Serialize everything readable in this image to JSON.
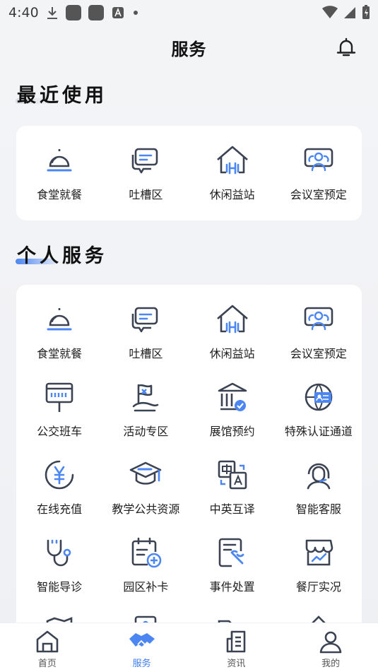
{
  "status": {
    "time": "4:40"
  },
  "header": {
    "title": "服务"
  },
  "recent": {
    "title": "最近使用",
    "items": [
      {
        "label": "食堂就餐",
        "icon": "cloche-icon"
      },
      {
        "label": "吐槽区",
        "icon": "chat-icon"
      },
      {
        "label": "休闲益站",
        "icon": "gym-house-icon"
      },
      {
        "label": "会议室预定",
        "icon": "meeting-room-icon"
      }
    ]
  },
  "personal": {
    "title": "个人服务",
    "items": [
      {
        "label": "食堂就餐",
        "icon": "cloche-icon"
      },
      {
        "label": "吐槽区",
        "icon": "chat-icon"
      },
      {
        "label": "休闲益站",
        "icon": "gym-house-icon"
      },
      {
        "label": "会议室预定",
        "icon": "meeting-room-icon"
      },
      {
        "label": "公交班车",
        "icon": "bus-stop-icon"
      },
      {
        "label": "活动专区",
        "icon": "flag-icon"
      },
      {
        "label": "展馆预约",
        "icon": "museum-icon"
      },
      {
        "label": "特殊认证通道",
        "icon": "id-globe-icon"
      },
      {
        "label": "在线充值",
        "icon": "yuan-icon"
      },
      {
        "label": "教学公共资源",
        "icon": "graduation-cap-icon"
      },
      {
        "label": "中英互译",
        "icon": "translate-icon"
      },
      {
        "label": "智能客服",
        "icon": "headset-icon"
      },
      {
        "label": "智能导诊",
        "icon": "stethoscope-icon"
      },
      {
        "label": "园区补卡",
        "icon": "calendar-add-icon"
      },
      {
        "label": "事件处置",
        "icon": "document-wrench-icon"
      },
      {
        "label": "餐厅实况",
        "icon": "store-chart-icon"
      }
    ]
  },
  "tabs": [
    {
      "label": "首页",
      "icon": "home-icon"
    },
    {
      "label": "服务",
      "icon": "handshake-icon",
      "active": true
    },
    {
      "label": "资讯",
      "icon": "news-icon"
    },
    {
      "label": "我的",
      "icon": "user-icon"
    }
  ],
  "colors": {
    "accent": "#3f7cf0",
    "icon_dark": "#3b4352",
    "icon_blue": "#4b86f2"
  }
}
